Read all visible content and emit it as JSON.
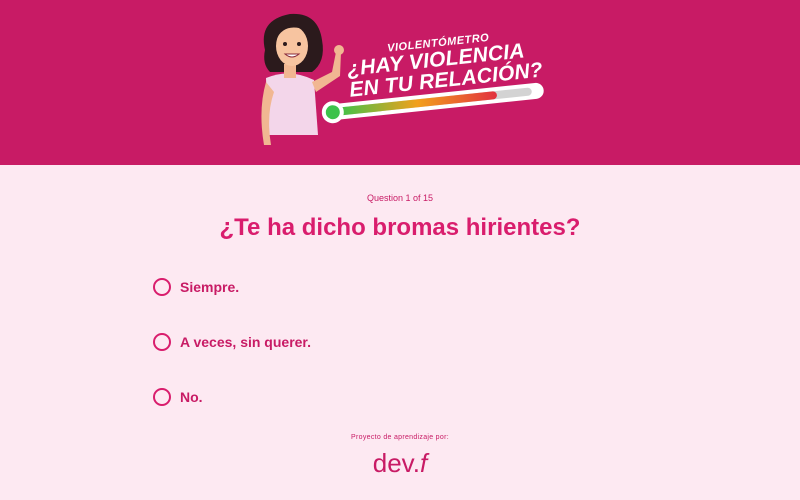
{
  "header": {
    "banner_small": "VIOLENTÓMETRO",
    "banner_line1": "¿HAY VIOLENCIA",
    "banner_line2": "EN TU RELACIÓN?",
    "colors": {
      "background": "#c81b65",
      "page": "#fde9f2",
      "accent": "#d91d6d"
    }
  },
  "quiz": {
    "counter": "Question 1 of 15",
    "question": "¿Te ha dicho bromas hirientes?",
    "options": [
      {
        "label": "Siempre."
      },
      {
        "label": "A veces, sin querer."
      },
      {
        "label": "No."
      }
    ]
  },
  "footer": {
    "note": "Proyecto de aprendizaje por:",
    "logo_main": "dev.",
    "logo_mark": "f"
  }
}
